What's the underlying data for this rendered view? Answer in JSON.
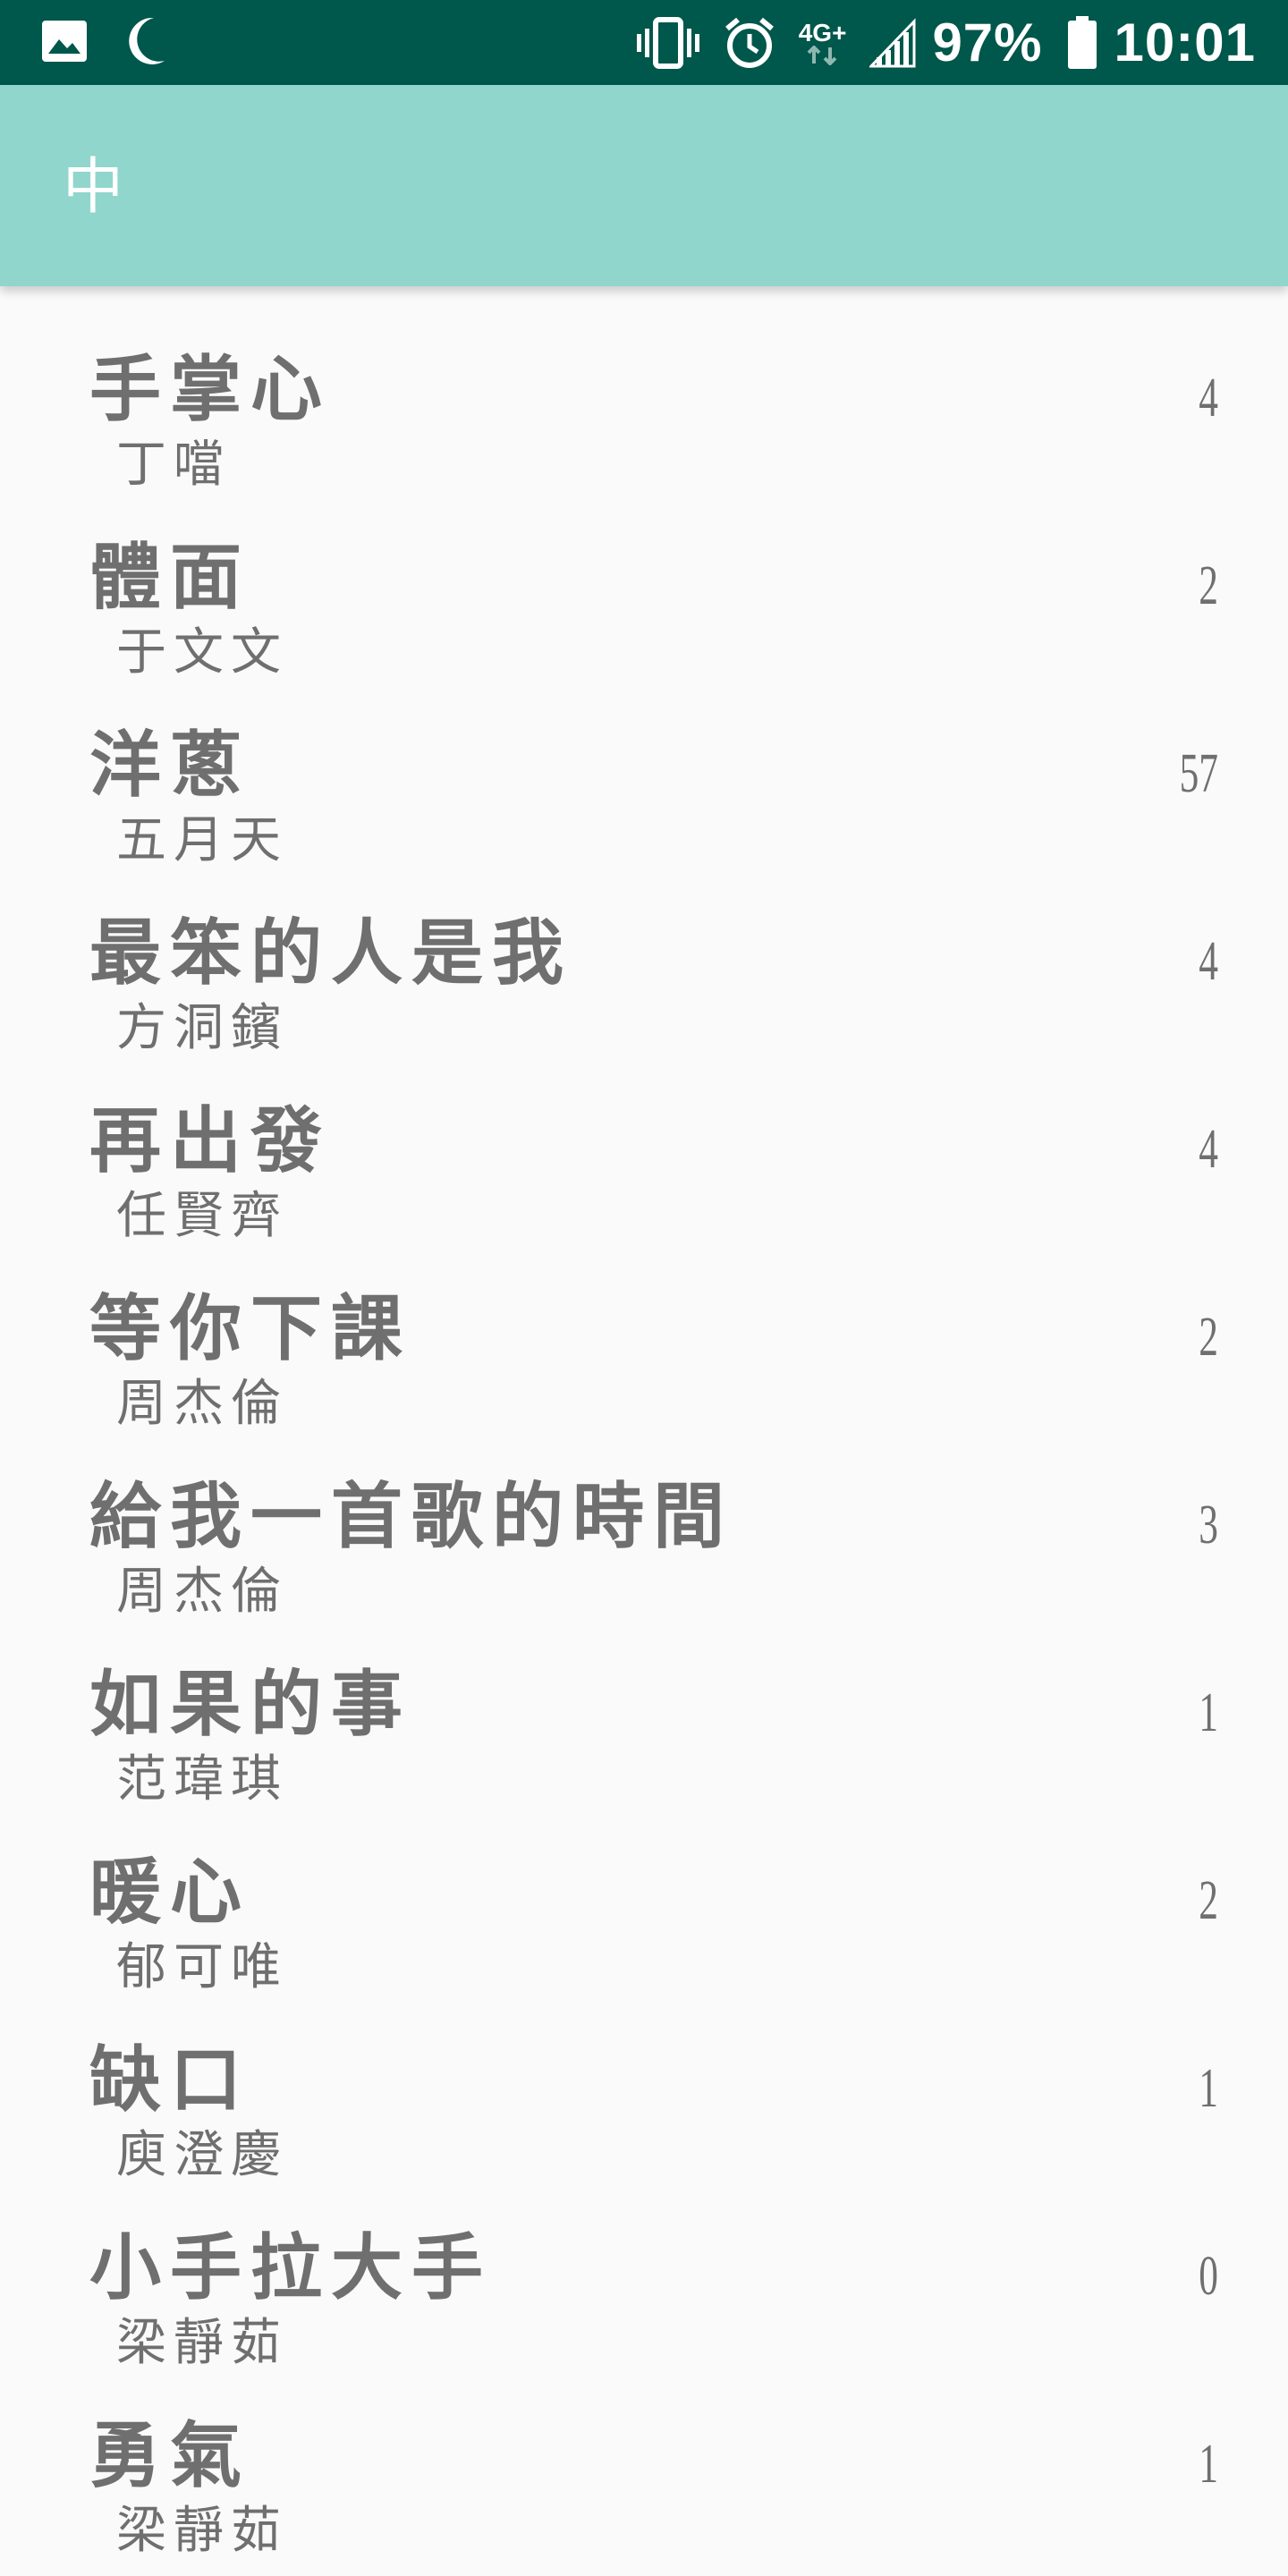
{
  "status_bar": {
    "battery_percent": "97%",
    "time": "10:01",
    "network": "4G+",
    "icons": [
      "image-icon",
      "moon-icon",
      "vibrate-icon",
      "alarm-icon",
      "network-4g-icon",
      "signal-icon",
      "battery-icon"
    ]
  },
  "app_bar": {
    "title": "中"
  },
  "songs": [
    {
      "title": "手掌心",
      "artist": "丁噹",
      "count": "4"
    },
    {
      "title": "體面",
      "artist": "于文文",
      "count": "2"
    },
    {
      "title": "洋蔥",
      "artist": "五月天",
      "count": "57"
    },
    {
      "title": "最笨的人是我",
      "artist": "方洞鑌",
      "count": "4"
    },
    {
      "title": "再出發",
      "artist": "任賢齊",
      "count": "4"
    },
    {
      "title": "等你下課",
      "artist": "周杰倫",
      "count": "2"
    },
    {
      "title": "給我一首歌的時間",
      "artist": "周杰倫",
      "count": "3"
    },
    {
      "title": "如果的事",
      "artist": "范瑋琪",
      "count": "1"
    },
    {
      "title": "暖心",
      "artist": "郁可唯",
      "count": "2"
    },
    {
      "title": "缺口",
      "artist": "庾澄慶",
      "count": "1"
    },
    {
      "title": "小手拉大手",
      "artist": "梁靜茹",
      "count": "0"
    },
    {
      "title": "勇氣",
      "artist": "梁靜茹",
      "count": "1"
    }
  ],
  "colors": {
    "status_bar": "#00574b",
    "app_bar": "#90d6cc",
    "background": "#fafafa",
    "text": "#6f6f6f"
  }
}
